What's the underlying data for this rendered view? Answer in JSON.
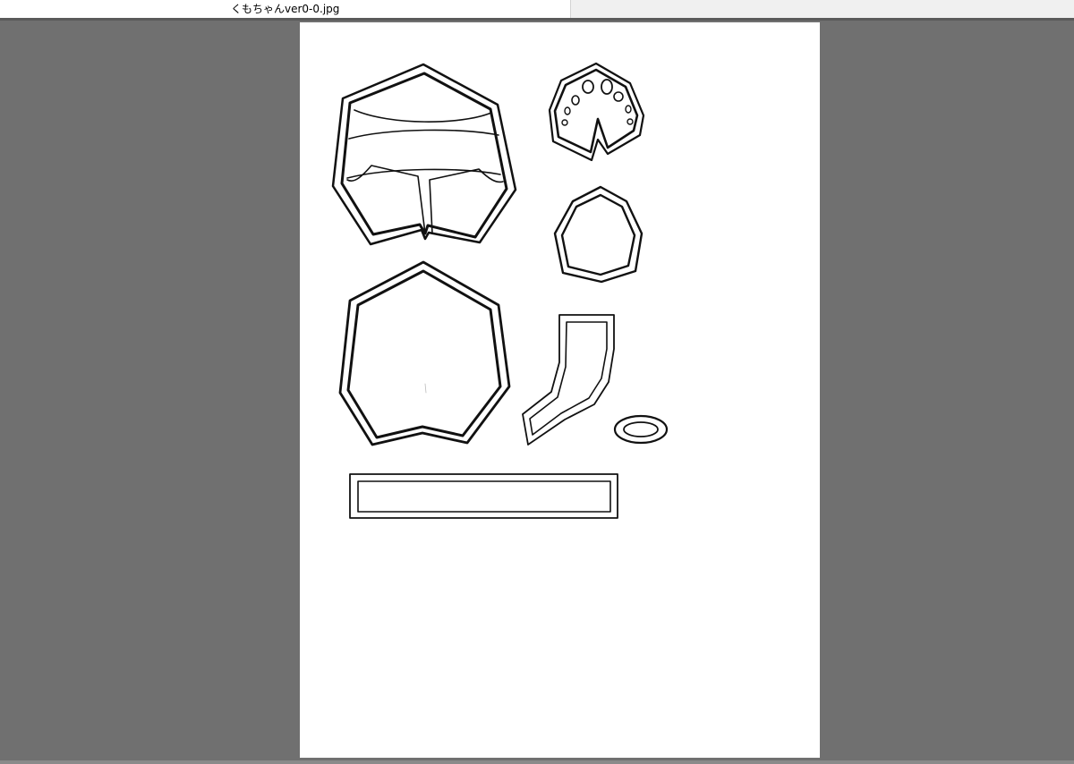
{
  "window": {
    "tab_title": "くもちゃんver0-0.jpg"
  },
  "colors": {
    "canvas_background": "#707070",
    "paper": "#ffffff",
    "stroke": "#111111"
  },
  "canvas": {
    "document": "paper-template",
    "pieces": [
      "hood-piece-icon",
      "eye-piece-icon",
      "round-piece-icon",
      "heptagon-piece-icon",
      "hook-piece-icon",
      "oval-ring-icon",
      "rectangle-strip-icon"
    ]
  }
}
